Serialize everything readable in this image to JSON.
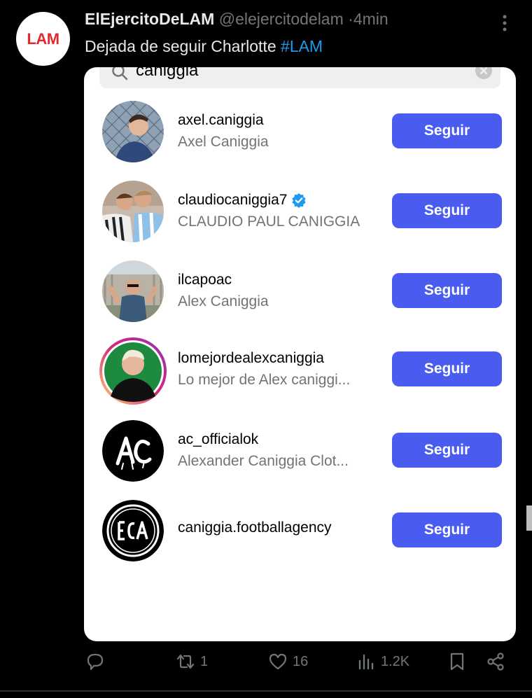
{
  "tweet": {
    "avatar_text": "LAM",
    "display_name": "ElEjercitoDeLAM",
    "handle": "@elejercitodelam",
    "separator": "·",
    "time": "4min",
    "text_before": "Dejada de seguir Charlotte",
    "hashtag": "#LAM"
  },
  "search": {
    "query": "caniggia"
  },
  "results": [
    {
      "username": "axel.caniggia",
      "fullname": "Axel  Caniggia",
      "verified": false,
      "button": "Seguir"
    },
    {
      "username": "claudiocaniggia7",
      "fullname": "CLAUDIO PAUL CANIGGIA",
      "verified": true,
      "button": "Seguir"
    },
    {
      "username": "ilcapoac",
      "fullname": "Alex Caniggia",
      "verified": false,
      "button": "Seguir"
    },
    {
      "username": "lomejordealexcaniggia",
      "fullname": "Lo mejor de Alex caniggi...",
      "verified": false,
      "button": "Seguir"
    },
    {
      "username": "ac_officialok",
      "fullname": "Alexander Caniggia Clot...",
      "verified": false,
      "button": "Seguir"
    },
    {
      "username": "caniggia.footballagency",
      "fullname": "",
      "verified": false,
      "button": "Seguir"
    }
  ],
  "actions": {
    "replies": "",
    "retweets": "1",
    "likes": "16",
    "views": "1.2K"
  },
  "colors": {
    "background": "#000000",
    "hashtag": "#1d9bf0",
    "follow_button": "#4a5cf0",
    "verified": "#1d9bf0"
  },
  "icons": [
    "more-icon",
    "search-icon",
    "clear-icon",
    "verified-icon",
    "reply-icon",
    "retweet-icon",
    "like-icon",
    "views-icon",
    "bookmark-icon",
    "share-icon"
  ]
}
